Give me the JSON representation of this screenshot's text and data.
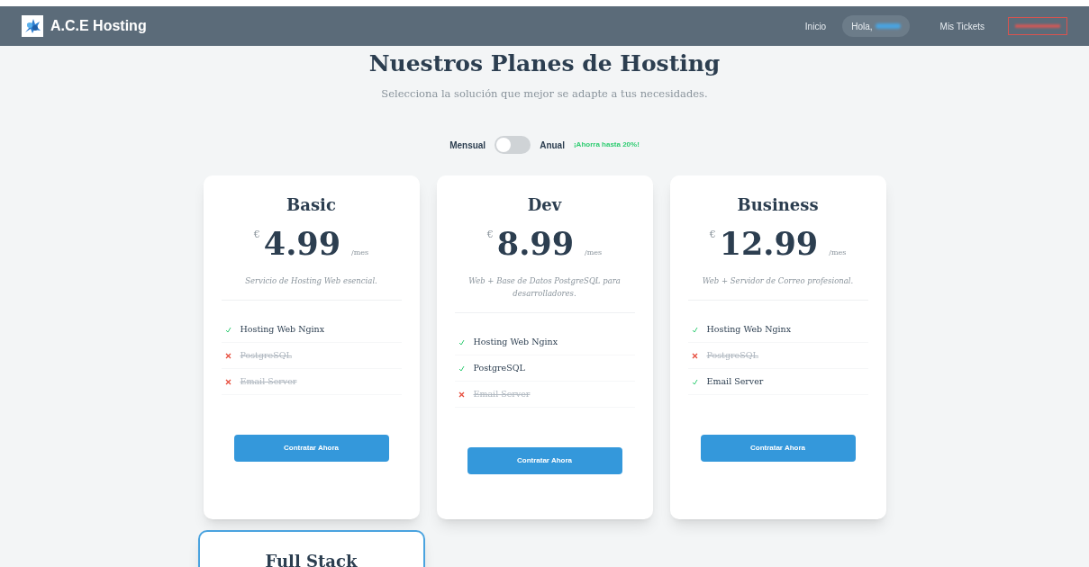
{
  "navbar": {
    "brand": "A.C.E Hosting",
    "links": [
      {
        "label": "Inicio"
      },
      {
        "label": "Mis Tickets"
      }
    ],
    "greeting": "Hola,"
  },
  "header": {
    "title": "Nuestros Planes de Hosting",
    "subtitle": "Selecciona la solución que mejor se adapte a tus necesidades."
  },
  "billing_toggle": {
    "left_label": "Mensual",
    "right_label": "Anual",
    "on": false,
    "badge": "¡Ahorra hasta 20%!"
  },
  "plans": [
    {
      "name": "Basic",
      "currency": "€",
      "price": "4.99",
      "period": "/mes",
      "description": "Servicio de Hosting Web esencial.",
      "features": [
        {
          "label": "Hosting Web Nginx",
          "included": true
        },
        {
          "label": "PostgreSQL",
          "included": false
        },
        {
          "label": "Email Server",
          "included": false
        }
      ],
      "button": "Contratar Ahora",
      "highlighted": false
    },
    {
      "name": "Dev",
      "currency": "€",
      "price": "8.99",
      "period": "/mes",
      "description": "Web + Base de Datos PostgreSQL para desarrolladores.",
      "features": [
        {
          "label": "Hosting Web Nginx",
          "included": true
        },
        {
          "label": "PostgreSQL",
          "included": true
        },
        {
          "label": "Email Server",
          "included": false
        }
      ],
      "button": "Contratar Ahora",
      "highlighted": false
    },
    {
      "name": "Business",
      "currency": "€",
      "price": "12.99",
      "period": "/mes",
      "description": "Web + Servidor de Correo profesional.",
      "features": [
        {
          "label": "Hosting Web Nginx",
          "included": true
        },
        {
          "label": "PostgreSQL",
          "included": false
        },
        {
          "label": "Email Server",
          "included": true
        }
      ],
      "button": "Contratar Ahora",
      "highlighted": false
    },
    {
      "name": "Full Stack",
      "highlighted": true
    }
  ]
}
